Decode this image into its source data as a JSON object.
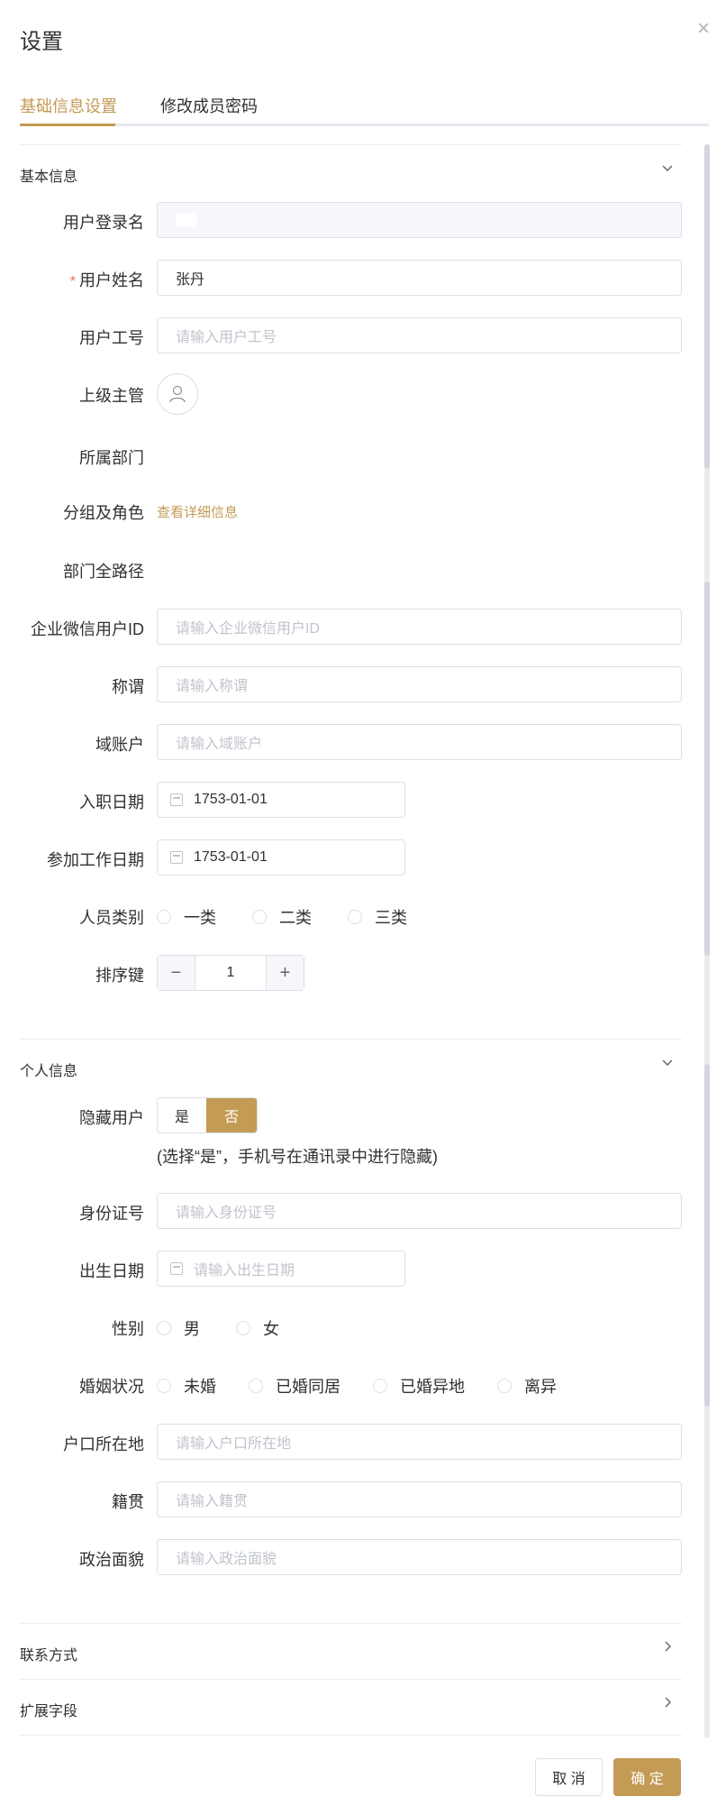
{
  "dialog": {
    "title": "设置",
    "close_symbol": "×"
  },
  "tabs": [
    {
      "label": "基础信息设置",
      "active": true
    },
    {
      "label": "修改成员密码",
      "active": false
    }
  ],
  "sections": {
    "basic": {
      "title": "基本信息"
    },
    "personal": {
      "title": "个人信息"
    },
    "contact": {
      "title": "联系方式"
    },
    "extended": {
      "title": "扩展字段"
    }
  },
  "basic": {
    "login_name": {
      "label": "用户登录名",
      "value": ""
    },
    "user_name": {
      "label": "用户姓名",
      "required_mark": "*",
      "value": "张丹"
    },
    "employee_no": {
      "label": "用户工号",
      "placeholder": "请输入用户工号"
    },
    "supervisor": {
      "label": "上级主管"
    },
    "department": {
      "label": "所属部门",
      "value": ""
    },
    "group_role": {
      "label": "分组及角色",
      "link": "查看详细信息"
    },
    "dept_path": {
      "label": "部门全路径",
      "value": ""
    },
    "wecom_id": {
      "label": "企业微信用户ID",
      "placeholder": "请输入企业微信用户ID"
    },
    "honorific": {
      "label": "称谓",
      "placeholder": "请输入称谓"
    },
    "domain_account": {
      "label": "域账户",
      "placeholder": "请输入域账户"
    },
    "hire_date": {
      "label": "入职日期",
      "value": "1753-01-01"
    },
    "work_start_date": {
      "label": "参加工作日期",
      "value": "1753-01-01"
    },
    "staff_category": {
      "label": "人员类别",
      "options": [
        "一类",
        "二类",
        "三类"
      ]
    },
    "sort_key": {
      "label": "排序键",
      "value": "1",
      "minus": "−",
      "plus": "+"
    }
  },
  "personal": {
    "hide_user": {
      "label": "隐藏用户",
      "options": [
        "是",
        "否"
      ],
      "selected": "否",
      "hint": "(选择“是”，手机号在通讯录中进行隐藏)"
    },
    "id_number": {
      "label": "身份证号",
      "placeholder": "请输入身份证号"
    },
    "birth_date": {
      "label": "出生日期",
      "placeholder": "请输入出生日期"
    },
    "gender": {
      "label": "性别",
      "options": [
        "男",
        "女"
      ]
    },
    "marital": {
      "label": "婚姻状况",
      "options": [
        "未婚",
        "已婚同居",
        "已婚异地",
        "离异"
      ]
    },
    "hukou": {
      "label": "户口所在地",
      "placeholder": "请输入户口所在地"
    },
    "native_place": {
      "label": "籍贯",
      "placeholder": "请输入籍贯"
    },
    "political": {
      "label": "政治面貌",
      "placeholder": "请输入政治面貌"
    }
  },
  "footer": {
    "cancel_label": "取 消",
    "ok_label": "确 定"
  },
  "colors": {
    "accent": "#c39b54",
    "required": "#f56c6c",
    "border": "#dcdfe6",
    "placeholder": "#c0c4cc"
  }
}
